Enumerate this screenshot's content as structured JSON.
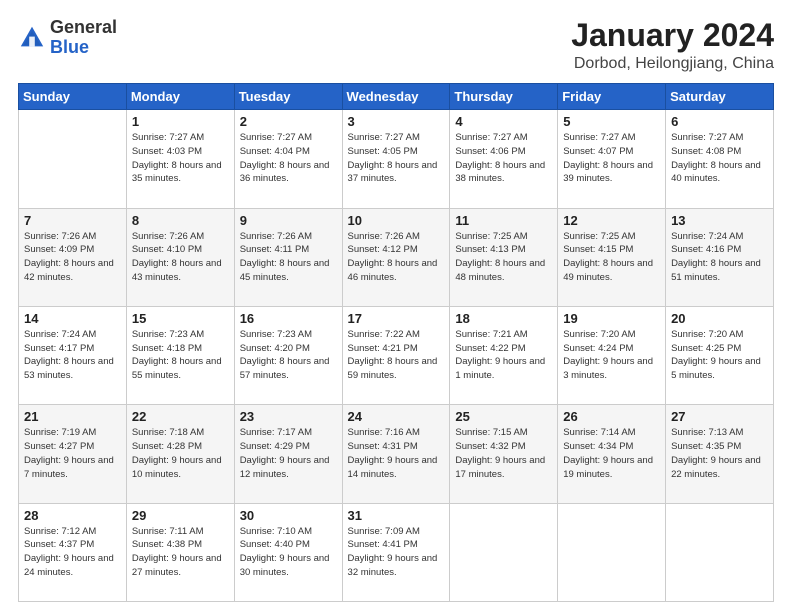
{
  "header": {
    "logo_general": "General",
    "logo_blue": "Blue",
    "month_title": "January 2024",
    "location": "Dorbod, Heilongjiang, China"
  },
  "days_of_week": [
    "Sunday",
    "Monday",
    "Tuesday",
    "Wednesday",
    "Thursday",
    "Friday",
    "Saturday"
  ],
  "weeks": [
    [
      {
        "day": "",
        "sunrise": "",
        "sunset": "",
        "daylight": ""
      },
      {
        "day": "1",
        "sunrise": "Sunrise: 7:27 AM",
        "sunset": "Sunset: 4:03 PM",
        "daylight": "Daylight: 8 hours and 35 minutes."
      },
      {
        "day": "2",
        "sunrise": "Sunrise: 7:27 AM",
        "sunset": "Sunset: 4:04 PM",
        "daylight": "Daylight: 8 hours and 36 minutes."
      },
      {
        "day": "3",
        "sunrise": "Sunrise: 7:27 AM",
        "sunset": "Sunset: 4:05 PM",
        "daylight": "Daylight: 8 hours and 37 minutes."
      },
      {
        "day": "4",
        "sunrise": "Sunrise: 7:27 AM",
        "sunset": "Sunset: 4:06 PM",
        "daylight": "Daylight: 8 hours and 38 minutes."
      },
      {
        "day": "5",
        "sunrise": "Sunrise: 7:27 AM",
        "sunset": "Sunset: 4:07 PM",
        "daylight": "Daylight: 8 hours and 39 minutes."
      },
      {
        "day": "6",
        "sunrise": "Sunrise: 7:27 AM",
        "sunset": "Sunset: 4:08 PM",
        "daylight": "Daylight: 8 hours and 40 minutes."
      }
    ],
    [
      {
        "day": "7",
        "sunrise": "Sunrise: 7:26 AM",
        "sunset": "Sunset: 4:09 PM",
        "daylight": "Daylight: 8 hours and 42 minutes."
      },
      {
        "day": "8",
        "sunrise": "Sunrise: 7:26 AM",
        "sunset": "Sunset: 4:10 PM",
        "daylight": "Daylight: 8 hours and 43 minutes."
      },
      {
        "day": "9",
        "sunrise": "Sunrise: 7:26 AM",
        "sunset": "Sunset: 4:11 PM",
        "daylight": "Daylight: 8 hours and 45 minutes."
      },
      {
        "day": "10",
        "sunrise": "Sunrise: 7:26 AM",
        "sunset": "Sunset: 4:12 PM",
        "daylight": "Daylight: 8 hours and 46 minutes."
      },
      {
        "day": "11",
        "sunrise": "Sunrise: 7:25 AM",
        "sunset": "Sunset: 4:13 PM",
        "daylight": "Daylight: 8 hours and 48 minutes."
      },
      {
        "day": "12",
        "sunrise": "Sunrise: 7:25 AM",
        "sunset": "Sunset: 4:15 PM",
        "daylight": "Daylight: 8 hours and 49 minutes."
      },
      {
        "day": "13",
        "sunrise": "Sunrise: 7:24 AM",
        "sunset": "Sunset: 4:16 PM",
        "daylight": "Daylight: 8 hours and 51 minutes."
      }
    ],
    [
      {
        "day": "14",
        "sunrise": "Sunrise: 7:24 AM",
        "sunset": "Sunset: 4:17 PM",
        "daylight": "Daylight: 8 hours and 53 minutes."
      },
      {
        "day": "15",
        "sunrise": "Sunrise: 7:23 AM",
        "sunset": "Sunset: 4:18 PM",
        "daylight": "Daylight: 8 hours and 55 minutes."
      },
      {
        "day": "16",
        "sunrise": "Sunrise: 7:23 AM",
        "sunset": "Sunset: 4:20 PM",
        "daylight": "Daylight: 8 hours and 57 minutes."
      },
      {
        "day": "17",
        "sunrise": "Sunrise: 7:22 AM",
        "sunset": "Sunset: 4:21 PM",
        "daylight": "Daylight: 8 hours and 59 minutes."
      },
      {
        "day": "18",
        "sunrise": "Sunrise: 7:21 AM",
        "sunset": "Sunset: 4:22 PM",
        "daylight": "Daylight: 9 hours and 1 minute."
      },
      {
        "day": "19",
        "sunrise": "Sunrise: 7:20 AM",
        "sunset": "Sunset: 4:24 PM",
        "daylight": "Daylight: 9 hours and 3 minutes."
      },
      {
        "day": "20",
        "sunrise": "Sunrise: 7:20 AM",
        "sunset": "Sunset: 4:25 PM",
        "daylight": "Daylight: 9 hours and 5 minutes."
      }
    ],
    [
      {
        "day": "21",
        "sunrise": "Sunrise: 7:19 AM",
        "sunset": "Sunset: 4:27 PM",
        "daylight": "Daylight: 9 hours and 7 minutes."
      },
      {
        "day": "22",
        "sunrise": "Sunrise: 7:18 AM",
        "sunset": "Sunset: 4:28 PM",
        "daylight": "Daylight: 9 hours and 10 minutes."
      },
      {
        "day": "23",
        "sunrise": "Sunrise: 7:17 AM",
        "sunset": "Sunset: 4:29 PM",
        "daylight": "Daylight: 9 hours and 12 minutes."
      },
      {
        "day": "24",
        "sunrise": "Sunrise: 7:16 AM",
        "sunset": "Sunset: 4:31 PM",
        "daylight": "Daylight: 9 hours and 14 minutes."
      },
      {
        "day": "25",
        "sunrise": "Sunrise: 7:15 AM",
        "sunset": "Sunset: 4:32 PM",
        "daylight": "Daylight: 9 hours and 17 minutes."
      },
      {
        "day": "26",
        "sunrise": "Sunrise: 7:14 AM",
        "sunset": "Sunset: 4:34 PM",
        "daylight": "Daylight: 9 hours and 19 minutes."
      },
      {
        "day": "27",
        "sunrise": "Sunrise: 7:13 AM",
        "sunset": "Sunset: 4:35 PM",
        "daylight": "Daylight: 9 hours and 22 minutes."
      }
    ],
    [
      {
        "day": "28",
        "sunrise": "Sunrise: 7:12 AM",
        "sunset": "Sunset: 4:37 PM",
        "daylight": "Daylight: 9 hours and 24 minutes."
      },
      {
        "day": "29",
        "sunrise": "Sunrise: 7:11 AM",
        "sunset": "Sunset: 4:38 PM",
        "daylight": "Daylight: 9 hours and 27 minutes."
      },
      {
        "day": "30",
        "sunrise": "Sunrise: 7:10 AM",
        "sunset": "Sunset: 4:40 PM",
        "daylight": "Daylight: 9 hours and 30 minutes."
      },
      {
        "day": "31",
        "sunrise": "Sunrise: 7:09 AM",
        "sunset": "Sunset: 4:41 PM",
        "daylight": "Daylight: 9 hours and 32 minutes."
      },
      {
        "day": "",
        "sunrise": "",
        "sunset": "",
        "daylight": ""
      },
      {
        "day": "",
        "sunrise": "",
        "sunset": "",
        "daylight": ""
      },
      {
        "day": "",
        "sunrise": "",
        "sunset": "",
        "daylight": ""
      }
    ]
  ]
}
